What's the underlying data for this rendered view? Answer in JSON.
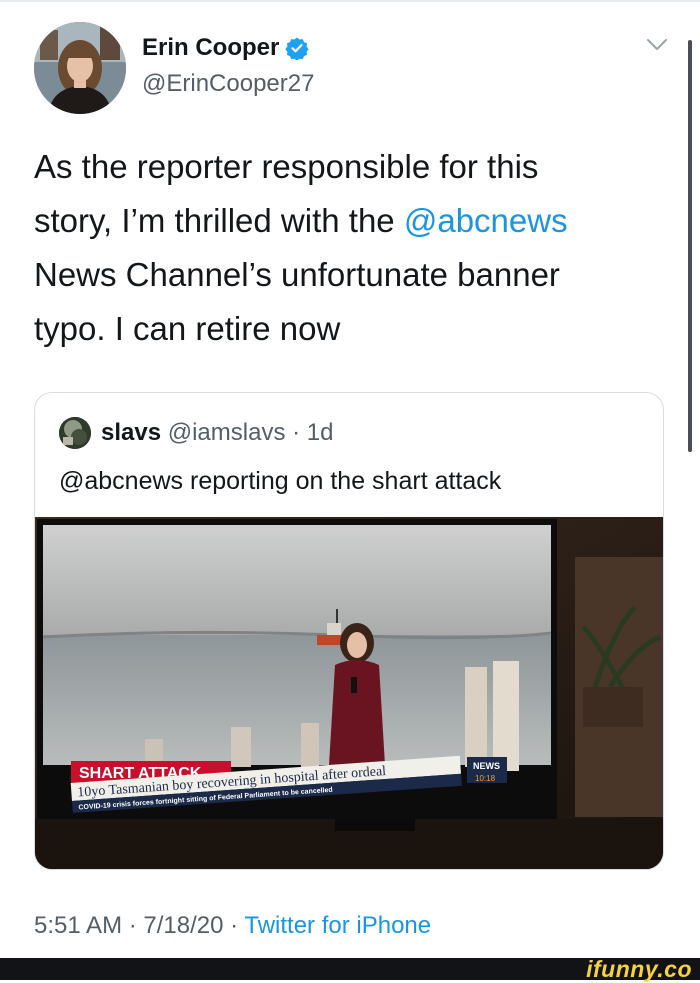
{
  "tweet": {
    "author_name": "Erin Cooper",
    "author_handle": "@ErinCooper27",
    "text_lines": {
      "line1": "As the reporter responsible for this",
      "line2_pre": "story, I’m thrilled with the ",
      "line2_mention": "@abcnews",
      "line3": "News Channel’s unfortunate banner",
      "line4": "typo. I can retire now"
    },
    "time": "5:51 AM",
    "sep1": " · ",
    "date": "7/18/20",
    "sep2": " · ",
    "source": "Twitter for iPhone"
  },
  "quote": {
    "name": "slavs",
    "handle": "@iamslavs",
    "dot": " · ",
    "age": "1d",
    "text": "@abcnews reporting on the shart attack"
  },
  "tv_banner": {
    "headline": "SHART ATTACK",
    "ticker1": "10yo Tasmanian boy recovering in hospital after ordeal",
    "ticker2": "COVID-19 crisis forces fortnight sitting of Federal Parliament to be cancelled",
    "channel_logo": "NEWS",
    "clock": "10:18"
  },
  "watermark": "ifunny.co",
  "colors": {
    "link": "#1b95e0",
    "secondary_text": "#545e66",
    "verified": "#1da1f2",
    "banner_red": "#c8102e"
  },
  "icons": {
    "verified": "verified-badge-icon",
    "caret": "chevron-down-icon"
  }
}
